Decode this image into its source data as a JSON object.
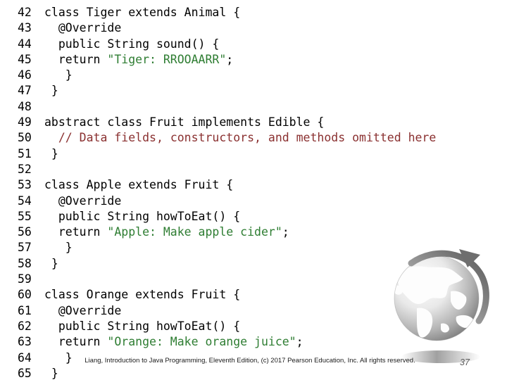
{
  "slide": {
    "background_color": "#ffffff",
    "page_number": "37",
    "footer_credit": "Liang, Introduction to Java Programming, Eleventh Edition, (c) 2017 Pearson Education, Inc. All rights reserved."
  },
  "colors": {
    "plain": "#000000",
    "string": "#2e7d32",
    "comment": "#8a3030",
    "page_number": "#5c5c5c"
  },
  "code": {
    "language": "java",
    "first_line_number": 42,
    "last_line_number": 65,
    "lines": [
      {
        "number": "42",
        "segments": [
          {
            "text": "class Tiger extends Animal {",
            "type": "plain"
          }
        ]
      },
      {
        "number": "43",
        "segments": [
          {
            "text": "  @Override",
            "type": "plain"
          }
        ]
      },
      {
        "number": "44",
        "segments": [
          {
            "text": "  public String sound() {",
            "type": "plain"
          }
        ]
      },
      {
        "number": "45",
        "segments": [
          {
            "text": "  return ",
            "type": "plain"
          },
          {
            "text": "\"Tiger: RROOAARR\"",
            "type": "string"
          },
          {
            "text": ";",
            "type": "plain"
          }
        ]
      },
      {
        "number": "46",
        "segments": [
          {
            "text": "   }",
            "type": "plain"
          }
        ]
      },
      {
        "number": "47",
        "segments": [
          {
            "text": " }",
            "type": "plain"
          }
        ]
      },
      {
        "number": "48",
        "segments": [
          {
            "text": "",
            "type": "plain"
          }
        ]
      },
      {
        "number": "49",
        "segments": [
          {
            "text": "abstract class Fruit implements Edible {",
            "type": "plain"
          }
        ]
      },
      {
        "number": "50",
        "segments": [
          {
            "text": "  ",
            "type": "plain"
          },
          {
            "text": "// Data fields, constructors, and methods omitted here",
            "type": "comment"
          }
        ]
      },
      {
        "number": "51",
        "segments": [
          {
            "text": " }",
            "type": "plain"
          }
        ]
      },
      {
        "number": "52",
        "segments": [
          {
            "text": "",
            "type": "plain"
          }
        ]
      },
      {
        "number": "53",
        "segments": [
          {
            "text": "class Apple extends Fruit {",
            "type": "plain"
          }
        ]
      },
      {
        "number": "54",
        "segments": [
          {
            "text": "  @Override",
            "type": "plain"
          }
        ]
      },
      {
        "number": "55",
        "segments": [
          {
            "text": "  public String howToEat() {",
            "type": "plain"
          }
        ]
      },
      {
        "number": "56",
        "segments": [
          {
            "text": "  return ",
            "type": "plain"
          },
          {
            "text": "\"Apple: Make apple cider\"",
            "type": "string"
          },
          {
            "text": ";",
            "type": "plain"
          }
        ]
      },
      {
        "number": "57",
        "segments": [
          {
            "text": "   }",
            "type": "plain"
          }
        ]
      },
      {
        "number": "58",
        "segments": [
          {
            "text": " }",
            "type": "plain"
          }
        ]
      },
      {
        "number": "59",
        "segments": [
          {
            "text": "",
            "type": "plain"
          }
        ]
      },
      {
        "number": "60",
        "segments": [
          {
            "text": "class Orange extends Fruit {",
            "type": "plain"
          }
        ]
      },
      {
        "number": "61",
        "segments": [
          {
            "text": "  @Override",
            "type": "plain"
          }
        ]
      },
      {
        "number": "62",
        "segments": [
          {
            "text": "  public String howToEat() {",
            "type": "plain"
          }
        ]
      },
      {
        "number": "63",
        "segments": [
          {
            "text": "  return ",
            "type": "plain"
          },
          {
            "text": "\"Orange: Make orange juice\"",
            "type": "string"
          },
          {
            "text": ";",
            "type": "plain"
          }
        ]
      },
      {
        "number": "64",
        "segments": [
          {
            "text": "   }",
            "type": "plain"
          }
        ]
      },
      {
        "number": "65",
        "segments": [
          {
            "text": " }",
            "type": "plain"
          }
        ]
      }
    ]
  }
}
